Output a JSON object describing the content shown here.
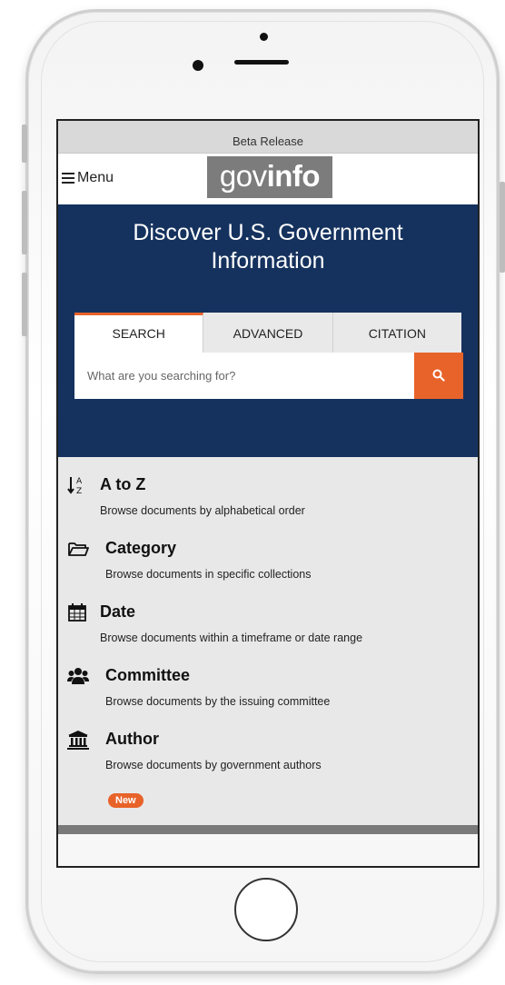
{
  "banner": {
    "text": "Beta Release"
  },
  "header": {
    "menu_label": "Menu",
    "logo_gov": "gov",
    "logo_info": "info"
  },
  "hero": {
    "title_line1": "Discover U.S. Government",
    "title_line2": "Information"
  },
  "tabs": [
    {
      "label": "SEARCH",
      "active": true
    },
    {
      "label": "ADVANCED",
      "active": false
    },
    {
      "label": "CITATION",
      "active": false
    }
  ],
  "search": {
    "placeholder": "What are you searching for?",
    "button_icon": "search-icon"
  },
  "browse": [
    {
      "title": "A to Z",
      "description": "Browse documents by alphabetical order",
      "icon": "sort-alpha-icon"
    },
    {
      "title": "Category",
      "description": "Browse documents in specific collections",
      "icon": "folder-icon"
    },
    {
      "title": "Date",
      "description": "Browse documents within a timeframe or date range",
      "icon": "calendar-icon"
    },
    {
      "title": "Committee",
      "description": "Browse documents by the issuing committee",
      "icon": "users-icon"
    },
    {
      "title": "Author",
      "description": "Browse documents by government authors",
      "icon": "institution-icon"
    }
  ],
  "badge": {
    "text": "New"
  },
  "colors": {
    "hero": "#15325e",
    "accent": "#e8632a",
    "logo_bg": "#7c7c7c"
  }
}
